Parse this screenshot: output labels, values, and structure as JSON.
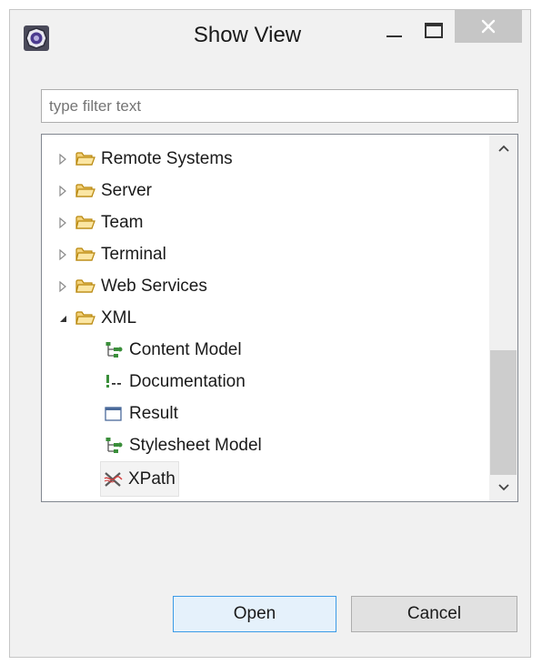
{
  "window": {
    "title": "Show View"
  },
  "filter": {
    "placeholder": "type filter text",
    "value": ""
  },
  "tree": {
    "items": [
      {
        "label": "Remote Systems",
        "type": "folder",
        "expanded": false
      },
      {
        "label": "Server",
        "type": "folder",
        "expanded": false
      },
      {
        "label": "Team",
        "type": "folder",
        "expanded": false
      },
      {
        "label": "Terminal",
        "type": "folder",
        "expanded": false
      },
      {
        "label": "Web Services",
        "type": "folder",
        "expanded": false
      },
      {
        "label": "XML",
        "type": "folder",
        "expanded": true
      },
      {
        "label": "Content Model",
        "type": "view",
        "icon": "tree-nodes-icon"
      },
      {
        "label": "Documentation",
        "type": "view",
        "icon": "xml-comment-icon"
      },
      {
        "label": "Result",
        "type": "view",
        "icon": "window-icon"
      },
      {
        "label": "Stylesheet Model",
        "type": "view",
        "icon": "tree-nodes-icon"
      },
      {
        "label": "XPath",
        "type": "view",
        "icon": "xpath-icon",
        "selected": true
      }
    ]
  },
  "buttons": {
    "open_label": "Open",
    "cancel_label": "Cancel"
  },
  "colors": {
    "dialog_bg": "#f1f1f1",
    "close_button_bg": "#c6c6c6",
    "default_button_border": "#3c9be6",
    "folder_fill": "#f3d27a",
    "folder_stroke": "#b8860b",
    "tree_icon_green": "#3a8e3a",
    "scrollbar_thumb": "#cdcdcd"
  }
}
